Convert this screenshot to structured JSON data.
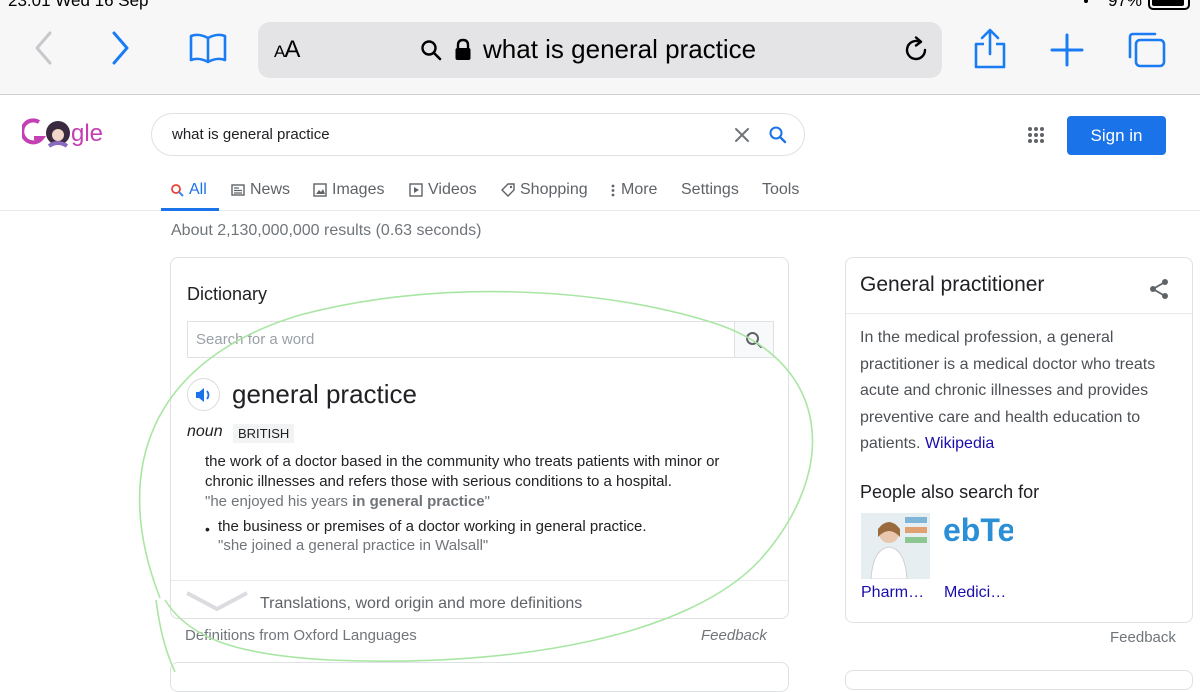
{
  "status_bar": {
    "time_date": "23:01   Wed 16 Sep",
    "battery": "97%"
  },
  "browser": {
    "text_size_label": "AA",
    "url_text": "what is general practice"
  },
  "google": {
    "logo_text": "gle",
    "search_value": "what is general practice",
    "signin_label": "Sign in",
    "tabs": [
      "All",
      "News",
      "Images",
      "Videos",
      "Shopping",
      "More",
      "Settings",
      "Tools"
    ],
    "result_stats": "About 2,130,000,000 results (0.63 seconds)"
  },
  "dictionary": {
    "title": "Dictionary",
    "search_placeholder": "Search for a word",
    "word": "general practice",
    "part_of_speech": "noun",
    "region": "BRITISH",
    "def1_line1": "the work of a doctor based in the community who treats patients with minor or",
    "def1_line2": "chronic illnesses and refers those with serious conditions to a hospital.",
    "ex1_pre": "\"he enjoyed his years ",
    "ex1_bold": "in general practice",
    "ex1_post": "\"",
    "def2": "the business or premises of a doctor working in general practice.",
    "ex2": "\"she joined a general practice in Walsall\"",
    "more_label": "Translations, word origin and more definitions",
    "footer_source": "Definitions from Oxford Languages",
    "feedback": "Feedback"
  },
  "knowledge_panel": {
    "title": "General practitioner",
    "description": "In the medical profession, a general practitioner is a medical doctor who treats acute and chronic illnesses and provides preventive care and health education to patients.",
    "source_link": "Wikipedia",
    "people_also_search": "People also search for",
    "items": [
      "Pharm…",
      "Medici…"
    ],
    "item2_logo_text": "ebTe",
    "feedback": "Feedback"
  },
  "colors": {
    "accent": "#1a73e8",
    "link": "#1a0dab",
    "annotation": "#9fe39a"
  }
}
